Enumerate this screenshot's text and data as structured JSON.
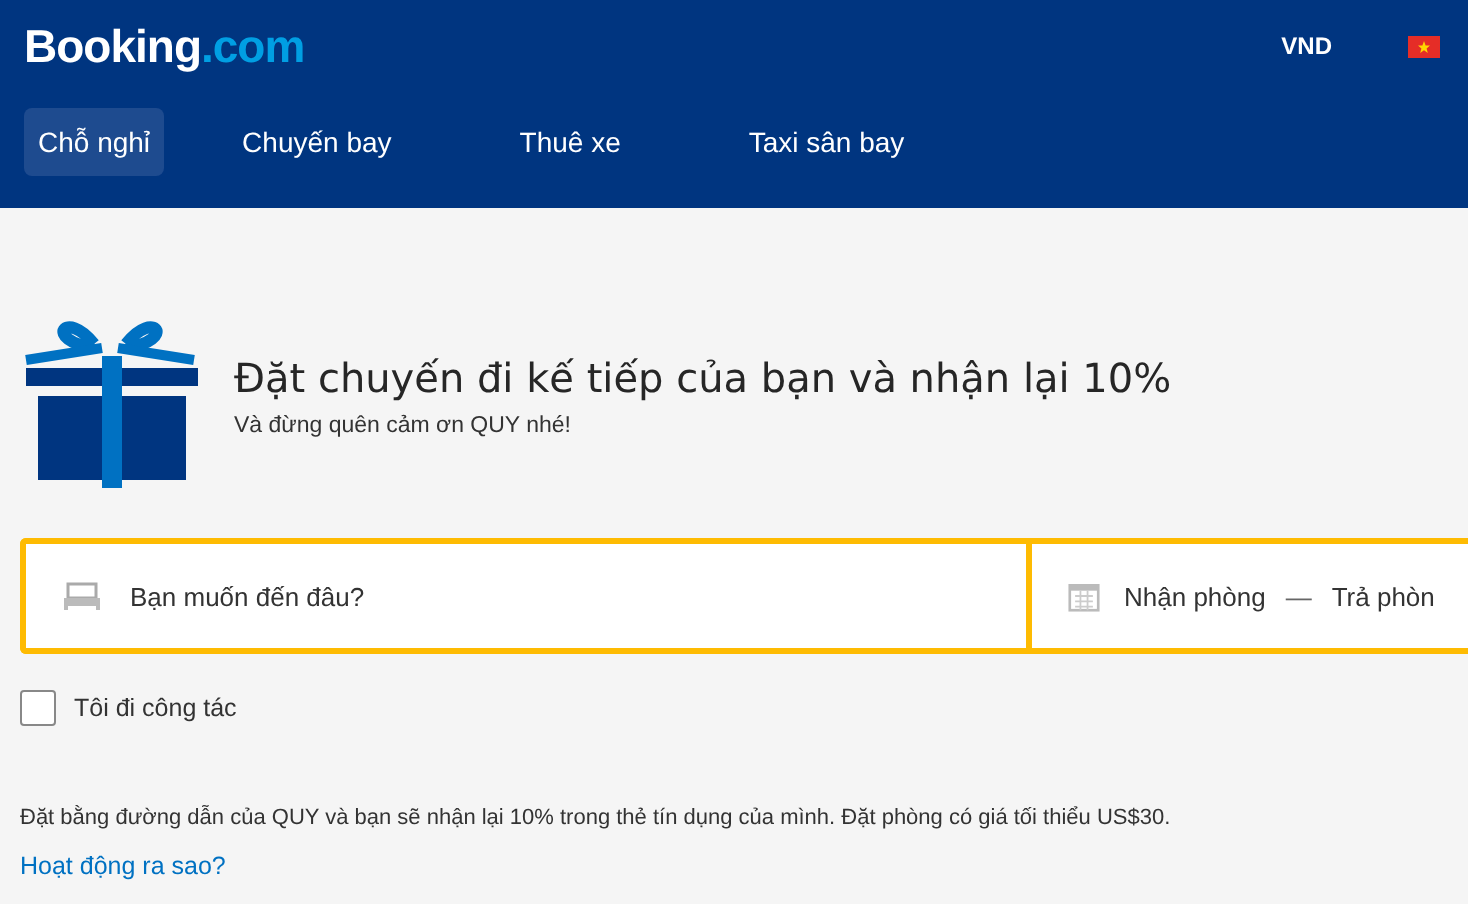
{
  "header": {
    "logo": {
      "brand": "Booking",
      "suffix": ".com"
    },
    "currency": "VND"
  },
  "nav": [
    {
      "label": "Chỗ nghỉ",
      "selected": true
    },
    {
      "label": "Chuyến bay",
      "selected": false
    },
    {
      "label": "Thuê xe",
      "selected": false
    },
    {
      "label": "Taxi sân bay",
      "selected": false
    }
  ],
  "promo": {
    "title": "Đặt chuyến đi kế tiếp của bạn và nhận lại 10%",
    "subtitle": "Và đừng quên cảm ơn QUY nhé!"
  },
  "search": {
    "destination": {
      "placeholder": "Bạn muốn đến đâu?"
    },
    "check_in": "Nhận phòng",
    "separator": "—",
    "check_out": "Trả phòn"
  },
  "business_trip": {
    "label": "Tôi đi công tác",
    "checked": false
  },
  "info": {
    "text": "Đặt bằng đường dẫn của QUY và bạn sẽ nhận lại 10% trong thẻ tín dụng của mình. Đặt phòng có giá tối thiểu US$30.",
    "link": "Hoạt động ra sao?"
  }
}
